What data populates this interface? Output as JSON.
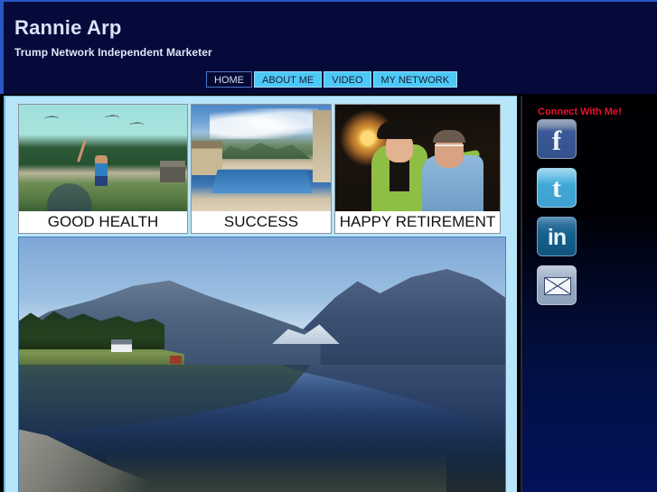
{
  "header": {
    "site_title": "Rannie Arp",
    "tagline": "Trump Network Independent Marketer"
  },
  "nav": {
    "items": [
      {
        "label": "HOME",
        "active": true
      },
      {
        "label": "ABOUT ME",
        "active": false
      },
      {
        "label": "VIDEO",
        "active": false
      },
      {
        "label": "MY NETWORK",
        "active": false
      }
    ]
  },
  "main": {
    "thumbnails": [
      {
        "caption": "GOOD HEALTH",
        "image_alt": "woman with raised arm on beach path with seagulls and trees"
      },
      {
        "caption": "SUCCESS",
        "image_alt": "luxury swimming pool with mountain view and dramatic clouds"
      },
      {
        "caption": "HAPPY RETIREMENT",
        "image_alt": "smiling older couple, woman in green jacket and black hat beside man in blue shirt"
      }
    ],
    "hero": {
      "image_alt": "fjord landscape with mountains mirrored in still blue water"
    }
  },
  "sidebar": {
    "connect_title": "Connect With Me!",
    "social_links": [
      {
        "name": "Facebook",
        "glyph": "f"
      },
      {
        "name": "Twitter",
        "glyph": "t"
      },
      {
        "name": "LinkedIn",
        "glyph": "in"
      },
      {
        "name": "Email",
        "glyph": ""
      }
    ]
  },
  "colors": {
    "header_bg": "#050a3a",
    "header_accent": "#2a56c6",
    "content_bg": "#b7e6fb",
    "nav_active_bg": "#060a33",
    "nav_bg": "#4cc9f7",
    "connect_red": "#e8112d",
    "sidebar_bottom": "#03125a"
  }
}
